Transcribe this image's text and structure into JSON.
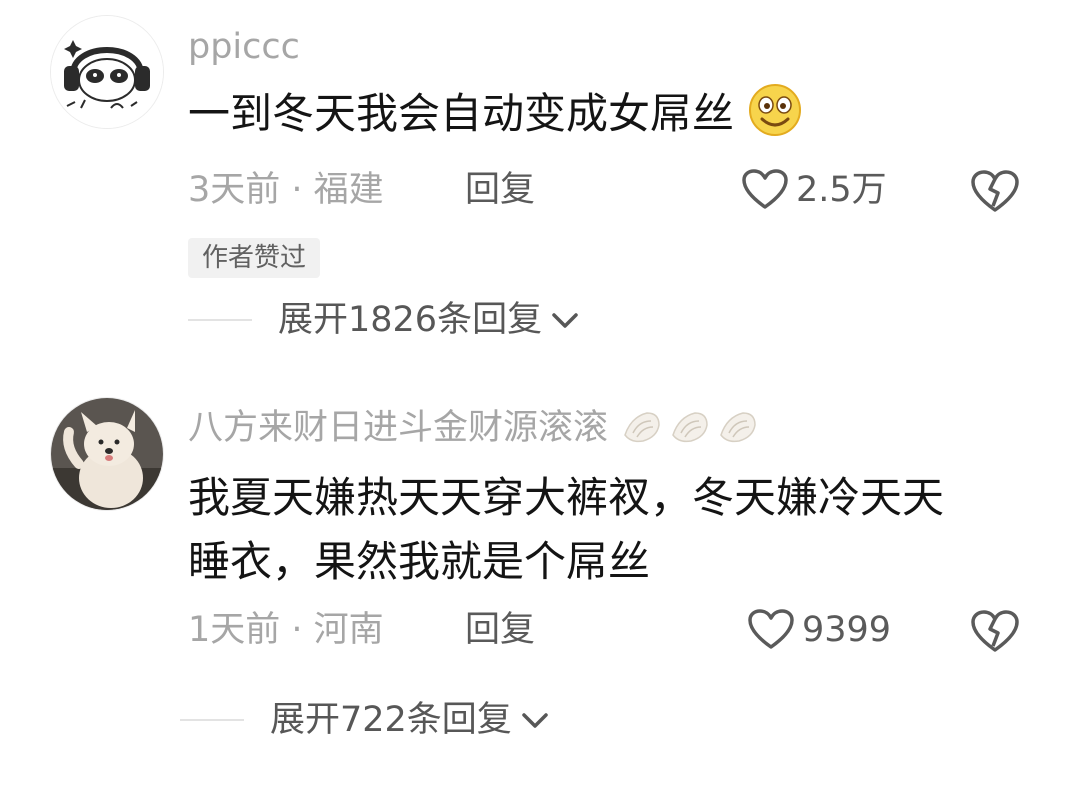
{
  "comments": [
    {
      "username": "ppiccc",
      "content": "一到冬天我会自动变成女屌丝",
      "emoji": "smiley-emoji",
      "meta": "3天前 · 福建",
      "reply_label": "回复",
      "like_count": "2.5万",
      "author_badge": "作者赞过",
      "expand_label": "展开1826条回复"
    },
    {
      "username": "八方来财日进斗金财源滚滚",
      "username_icons": [
        "conch-shell-icon",
        "conch-shell-icon",
        "conch-shell-icon"
      ],
      "content_line1": "我夏天嫌热天天穿大裤衩，冬天嫌冷天天",
      "content_line2": "睡衣，果然我就是个屌丝",
      "meta": "1天前 · 河南",
      "reply_label": "回复",
      "like_count": "9399",
      "expand_label": "展开722条回复"
    }
  ],
  "colors": {
    "text_primary": "#141414",
    "text_secondary": "#a6a6a6",
    "action": "#5a5a5a",
    "badge_bg": "#f1f1f1"
  }
}
